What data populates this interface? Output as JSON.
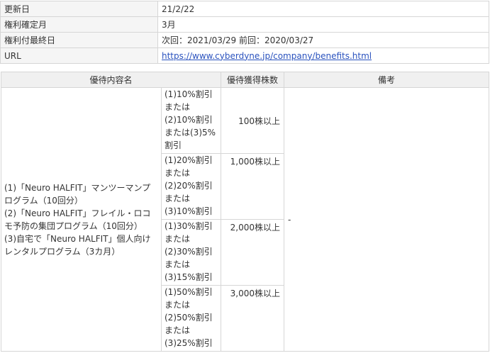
{
  "info": [
    {
      "label": "更新日",
      "value": "21/2/22"
    },
    {
      "label": "権利確定月",
      "value": "3月"
    },
    {
      "label": "権利付最終日",
      "value": "次回：2021/03/29 前回：2020/03/27"
    },
    {
      "label": "URL",
      "value": "https://www.cyberdyne.jp/company/benefits.html"
    }
  ],
  "benefits": {
    "headers": {
      "content": "優待内容名",
      "shares": "優待獲得株数",
      "note": "備考"
    },
    "content_lines": [
      "(1)「Neuro HALFIT」マンツーマンプログラム（10回分）",
      "(2)「Neuro HALFIT」フレイル・ロコモ予防の集団プログラム（10回分）",
      "(3)自宅で「Neuro HALFIT」個人向けレンタルプログラム（3カ月）"
    ],
    "note": "-",
    "tiers": [
      {
        "lines": [
          "(1)10%割引",
          "または",
          "(2)10%割引",
          "または(3)5%",
          "割引"
        ],
        "shares": "100株以上"
      },
      {
        "lines": [
          "(1)20%割引",
          "または",
          "(2)20%割引",
          "または",
          "(3)10%割引"
        ],
        "shares": "1,000株以上"
      },
      {
        "lines": [
          "(1)30%割引",
          "または",
          "(2)30%割引",
          "または",
          "(3)15%割引"
        ],
        "shares": "2,000株以上"
      },
      {
        "lines": [
          "(1)50%割引",
          "または",
          "(2)50%割引",
          "または",
          "(3)25%割引"
        ],
        "shares": "3,000株以上"
      }
    ]
  }
}
